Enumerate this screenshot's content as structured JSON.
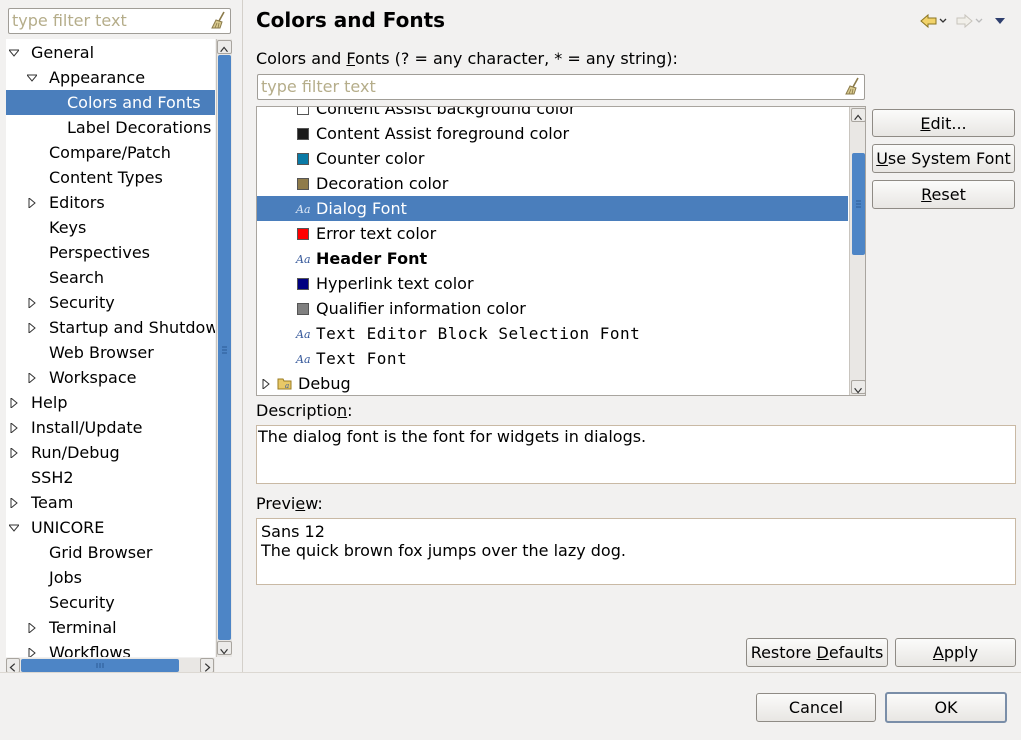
{
  "page": {
    "title": "Colors and Fonts"
  },
  "tree_filter": {
    "placeholder": "type filter text"
  },
  "tree": [
    {
      "label": "General",
      "indent": 0,
      "expander": "expanded"
    },
    {
      "label": "Appearance",
      "indent": 1,
      "expander": "expanded"
    },
    {
      "label": "Colors and Fonts",
      "indent": 2,
      "expander": "none",
      "selected": true
    },
    {
      "label": "Label Decorations",
      "indent": 2,
      "expander": "none"
    },
    {
      "label": "Compare/Patch",
      "indent": 1,
      "expander": "none"
    },
    {
      "label": "Content Types",
      "indent": 1,
      "expander": "none"
    },
    {
      "label": "Editors",
      "indent": 1,
      "expander": "collapsed"
    },
    {
      "label": "Keys",
      "indent": 1,
      "expander": "none"
    },
    {
      "label": "Perspectives",
      "indent": 1,
      "expander": "none"
    },
    {
      "label": "Search",
      "indent": 1,
      "expander": "none"
    },
    {
      "label": "Security",
      "indent": 1,
      "expander": "collapsed"
    },
    {
      "label": "Startup and Shutdown",
      "indent": 1,
      "expander": "collapsed"
    },
    {
      "label": "Web Browser",
      "indent": 1,
      "expander": "none"
    },
    {
      "label": "Workspace",
      "indent": 1,
      "expander": "collapsed"
    },
    {
      "label": "Help",
      "indent": 0,
      "expander": "collapsed"
    },
    {
      "label": "Install/Update",
      "indent": 0,
      "expander": "collapsed"
    },
    {
      "label": "Run/Debug",
      "indent": 0,
      "expander": "collapsed"
    },
    {
      "label": "SSH2",
      "indent": 0,
      "expander": "none"
    },
    {
      "label": "Team",
      "indent": 0,
      "expander": "collapsed"
    },
    {
      "label": "UNICORE",
      "indent": 0,
      "expander": "expanded"
    },
    {
      "label": "Grid Browser",
      "indent": 1,
      "expander": "none"
    },
    {
      "label": "Jobs",
      "indent": 1,
      "expander": "none"
    },
    {
      "label": "Security",
      "indent": 1,
      "expander": "none"
    },
    {
      "label": "Terminal",
      "indent": 1,
      "expander": "collapsed"
    },
    {
      "label": "Workflows",
      "indent": 1,
      "expander": "collapsed"
    }
  ],
  "colors_fonts_label": {
    "pre": "Colors and ",
    "mnemonic": "F",
    "post": "onts (? = any character, * = any string):"
  },
  "list_filter": {
    "placeholder": "type filter text"
  },
  "list": [
    {
      "label": "Content Assist background color",
      "kind": "color",
      "color": "#ffffff"
    },
    {
      "label": "Content Assist foreground color",
      "kind": "color",
      "color": "#1a1a1a"
    },
    {
      "label": "Counter color",
      "kind": "color",
      "color": "#0a7aa6"
    },
    {
      "label": "Decoration color",
      "kind": "color",
      "color": "#8f7b4a"
    },
    {
      "label": "Dialog Font",
      "kind": "font",
      "selected": true
    },
    {
      "label": "Error text color",
      "kind": "color",
      "color": "#ff0000"
    },
    {
      "label": "Header Font",
      "kind": "font",
      "bold": true
    },
    {
      "label": "Hyperlink text color",
      "kind": "color",
      "color": "#000080"
    },
    {
      "label": "Qualifier information color",
      "kind": "color",
      "color": "#808080"
    },
    {
      "label": "Text Editor Block Selection Font",
      "kind": "font",
      "mono": true
    },
    {
      "label": "Text Font",
      "kind": "font",
      "mono": true
    },
    {
      "label": "Debug",
      "kind": "category"
    }
  ],
  "font_icon_glyph": "Aa",
  "buttons": {
    "edit": {
      "pre": "",
      "mnemonic": "E",
      "post": "dit..."
    },
    "use_system_font": {
      "pre": "",
      "mnemonic": "U",
      "post": "se System Font"
    },
    "reset": {
      "pre": "",
      "mnemonic": "R",
      "post": "eset"
    },
    "restore_defaults": {
      "pre": "Restore ",
      "mnemonic": "D",
      "post": "efaults"
    },
    "apply": {
      "pre": "",
      "mnemonic": "A",
      "post": "pply"
    },
    "cancel": "Cancel",
    "ok": "OK"
  },
  "description": {
    "label_pre": "Descriptio",
    "label_mnemonic": "n",
    "label_post": ":",
    "text": "The dialog font is the font for widgets in dialogs."
  },
  "preview": {
    "label_pre": "Previ",
    "label_mnemonic": "e",
    "label_post": "w:",
    "line1": "Sans 12",
    "line2": "The quick brown fox jumps over the lazy dog."
  },
  "colors": {
    "selection": "#4a7ebc",
    "scroll_thumb": "#4d85c6",
    "background": "#f2f1f0"
  }
}
